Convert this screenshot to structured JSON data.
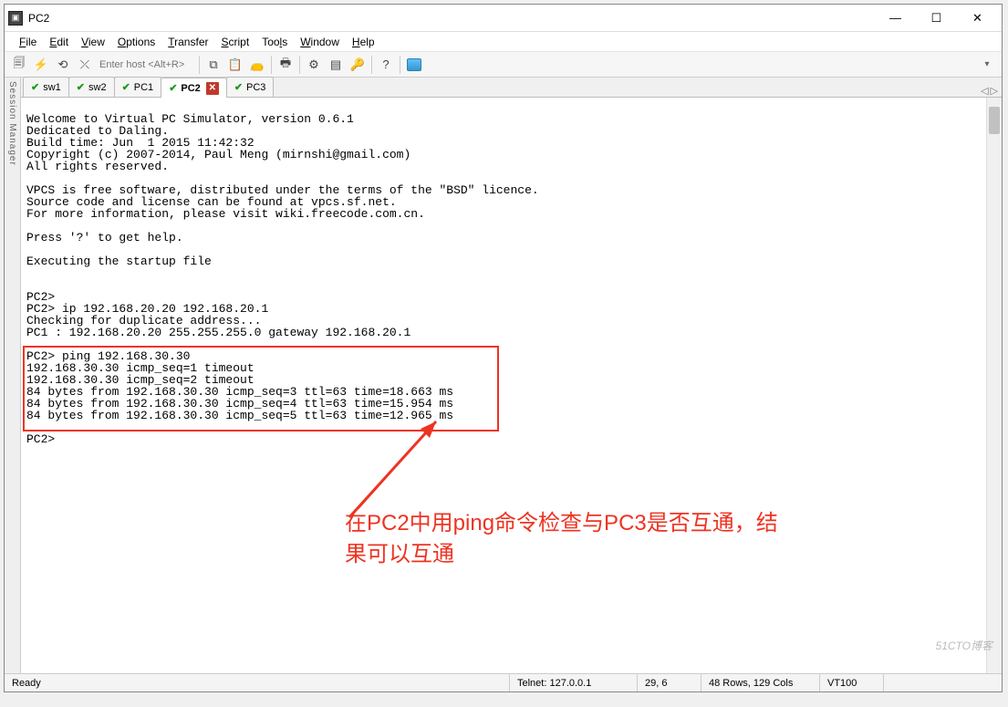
{
  "window": {
    "title": "PC2"
  },
  "menus": {
    "file": "File",
    "edit": "Edit",
    "view": "View",
    "options": "Options",
    "transfer": "Transfer",
    "script": "Script",
    "tools": "Tools",
    "window": "Window",
    "help": "Help"
  },
  "toolbar": {
    "host_placeholder": "Enter host <Alt+R>"
  },
  "session_mgr_label": "Session Manager",
  "tabs": [
    {
      "name": "sw1",
      "active": false
    },
    {
      "name": "sw2",
      "active": false
    },
    {
      "name": "PC1",
      "active": false
    },
    {
      "name": "PC2",
      "active": true,
      "closable": true
    },
    {
      "name": "PC3",
      "active": false
    }
  ],
  "tab_nav": {
    "left": "◁",
    "right": "▷"
  },
  "terminal_lines": [
    "",
    "Welcome to Virtual PC Simulator, version 0.6.1",
    "Dedicated to Daling.",
    "Build time: Jun  1 2015 11:42:32",
    "Copyright (c) 2007-2014, Paul Meng (mirnshi@gmail.com)",
    "All rights reserved.",
    "",
    "VPCS is free software, distributed under the terms of the \"BSD\" licence.",
    "Source code and license can be found at vpcs.sf.net.",
    "For more information, please visit wiki.freecode.com.cn.",
    "",
    "Press '?' to get help.",
    "",
    "Executing the startup file",
    "",
    "",
    "PC2>",
    "PC2> ip 192.168.20.20 192.168.20.1",
    "Checking for duplicate address...",
    "PC1 : 192.168.20.20 255.255.255.0 gateway 192.168.20.1",
    "",
    "PC2> ping 192.168.30.30",
    "192.168.30.30 icmp_seq=1 timeout",
    "192.168.30.30 icmp_seq=2 timeout",
    "84 bytes from 192.168.30.30 icmp_seq=3 ttl=63 time=18.663 ms",
    "84 bytes from 192.168.30.30 icmp_seq=4 ttl=63 time=15.954 ms",
    "84 bytes from 192.168.30.30 icmp_seq=5 ttl=63 time=12.965 ms",
    "",
    "PC2>"
  ],
  "annotation": {
    "text_line1": "在PC2中用ping命令检查与PC3是否互通，结",
    "text_line2": "果可以互通"
  },
  "status": {
    "ready": "Ready",
    "telnet": "Telnet: 127.0.0.1",
    "pos": "29,   6",
    "size": "48 Rows, 129 Cols",
    "term": "VT100"
  },
  "watermark": "51CTO博客"
}
